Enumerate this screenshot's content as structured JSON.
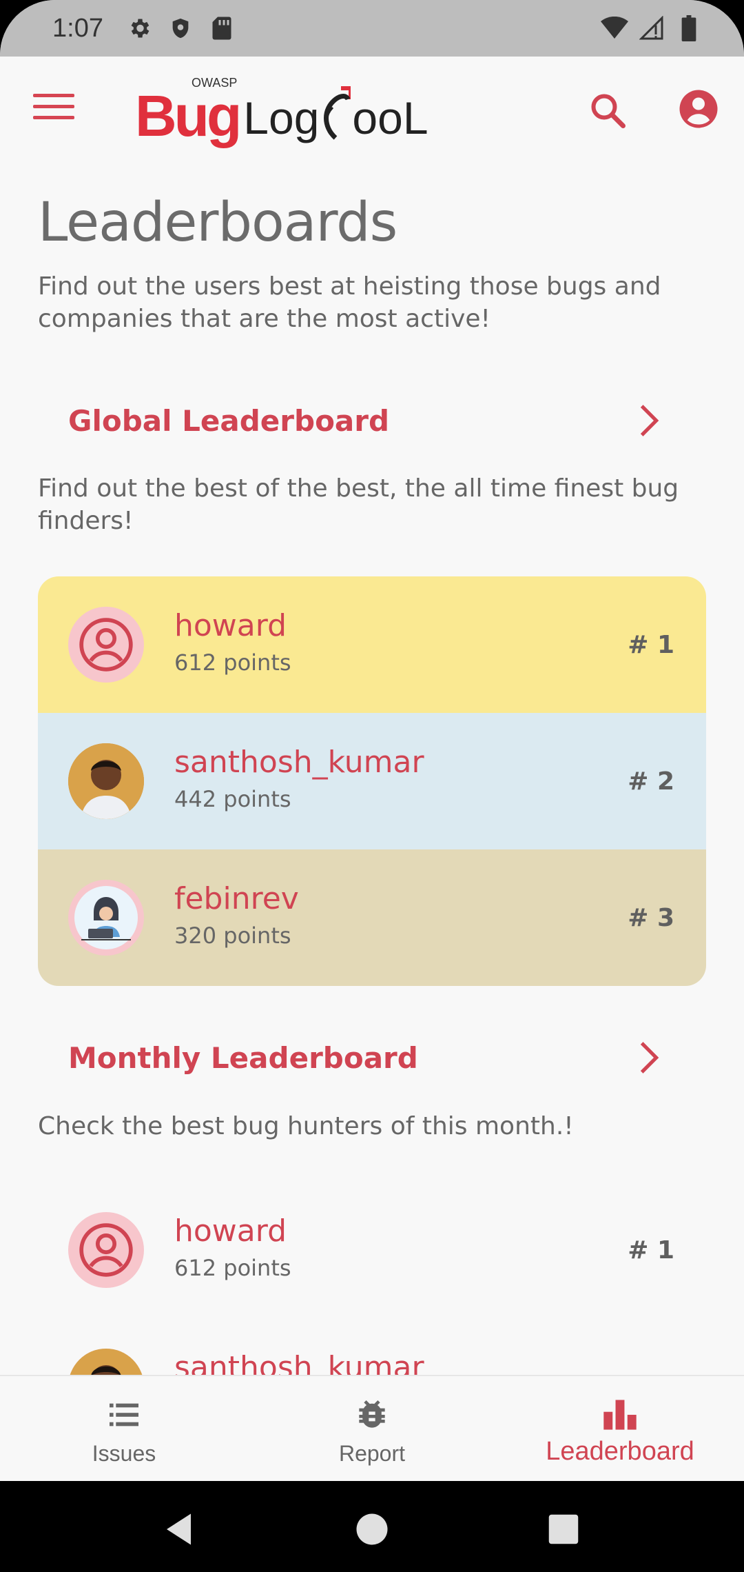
{
  "status_bar": {
    "time": "1:07",
    "icons": [
      "settings-icon",
      "shield-icon",
      "sd-card-icon",
      "wifi-icon",
      "signal-icon",
      "battery-icon"
    ]
  },
  "app_bar": {
    "logo": {
      "owasp": "OWASP",
      "bug": "Bug",
      "log": "Log",
      "tool": "ooL"
    },
    "icons": [
      "menu-icon",
      "search-icon",
      "account-icon"
    ]
  },
  "page": {
    "title": "Leaderboards",
    "description": "Find out the users best at heisting those bugs and companies that are the most active!"
  },
  "global": {
    "title": "Global Leaderboard",
    "description": "Find out the best of the best, the all time finest bug finders!",
    "entries": [
      {
        "name": "howard",
        "points": "612 points",
        "rank": "# 1",
        "avatar": "default-avatar-icon"
      },
      {
        "name": "santhosh_kumar",
        "points": "442 points",
        "rank": "# 2",
        "avatar": "photo-avatar"
      },
      {
        "name": "febinrev",
        "points": "320 points",
        "rank": "# 3",
        "avatar": "illustrated-avatar"
      }
    ]
  },
  "monthly": {
    "title": "Monthly Leaderboard",
    "description": "Check the best bug hunters of this month.!",
    "entries": [
      {
        "name": "howard",
        "points": "612 points",
        "rank": "# 1",
        "avatar": "default-avatar-icon"
      },
      {
        "name": "santhosh_kumar",
        "points": "",
        "rank": "",
        "avatar": "photo-avatar"
      }
    ]
  },
  "bottom_nav": {
    "items": [
      {
        "label": "Issues",
        "icon": "list-icon",
        "active": false
      },
      {
        "label": "Report",
        "icon": "bug-icon",
        "active": false
      },
      {
        "label": "Leaderboard",
        "icon": "bar-chart-icon",
        "active": true
      }
    ]
  },
  "colors": {
    "accent": "#d04452",
    "rank1_bg": "#fae992",
    "rank2_bg": "#dbeaf1",
    "rank3_bg": "#e3d9b7"
  }
}
